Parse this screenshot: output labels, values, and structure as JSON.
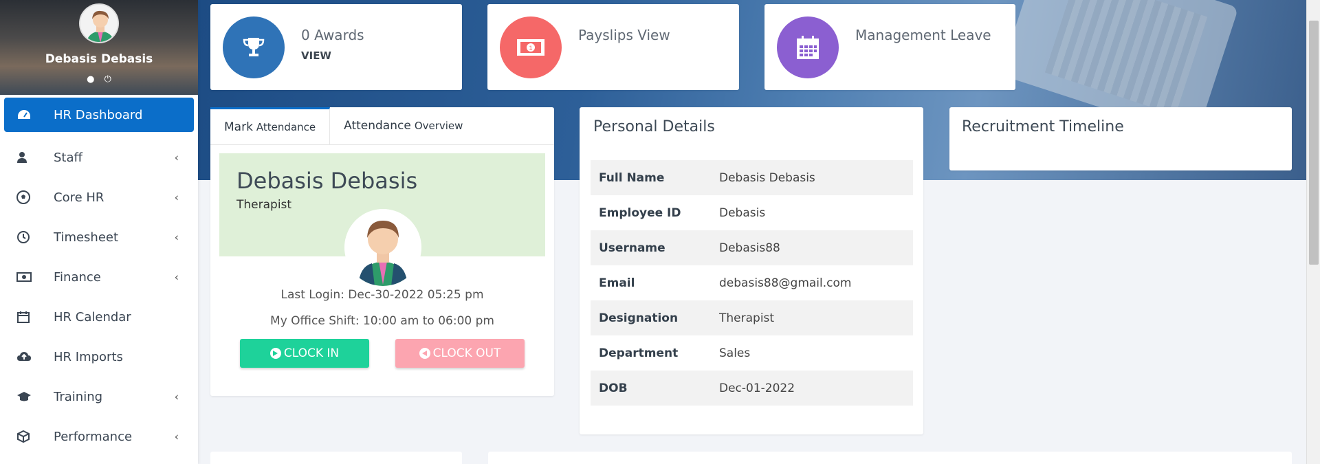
{
  "sidebar": {
    "profile": {
      "name": "Debasis Debasis"
    },
    "items": [
      {
        "label": "HR Dashboard",
        "icon": "dashboard-icon",
        "active": true,
        "has_submenu": false
      },
      {
        "label": "Staff",
        "icon": "user-icon",
        "has_submenu": true
      },
      {
        "label": "Core HR",
        "icon": "soccer-ball-icon",
        "has_submenu": true
      },
      {
        "label": "Timesheet",
        "icon": "clock-icon",
        "has_submenu": true
      },
      {
        "label": "Finance",
        "icon": "money-bill-icon",
        "has_submenu": true
      },
      {
        "label": "HR Calendar",
        "icon": "calendar-icon",
        "has_submenu": false
      },
      {
        "label": "HR Imports",
        "icon": "cloud-upload-icon",
        "has_submenu": false
      },
      {
        "label": "Training",
        "icon": "graduation-cap-icon",
        "has_submenu": true
      },
      {
        "label": "Performance",
        "icon": "cube-icon",
        "has_submenu": true
      }
    ]
  },
  "stats": [
    {
      "title": "0 Awards",
      "sub": "VIEW",
      "icon": "trophy-icon",
      "color": "#2f73b7"
    },
    {
      "title": "Payslips View",
      "sub": "",
      "icon": "money-bill-icon",
      "color": "#f56868"
    },
    {
      "title": "Management Leave",
      "sub": "",
      "icon": "calendar-icon",
      "color": "#8b5fd1"
    }
  ],
  "attendance": {
    "tabs": [
      {
        "main": "Mark",
        "small": "Attendance"
      },
      {
        "main": "Attendance",
        "small": "Overview"
      }
    ],
    "employee_name": "Debasis Debasis",
    "employee_role": "Therapist",
    "last_login": "Last Login: Dec-30-2022 05:25 pm",
    "office_shift": "My Office Shift: 10:00 am to 06:00 pm",
    "clock_in_label": "CLOCK IN",
    "clock_out_label": "CLOCK OUT"
  },
  "personal_details": {
    "title": "Personal Details",
    "rows": [
      {
        "key": "Full Name",
        "value": "Debasis Debasis"
      },
      {
        "key": "Employee ID",
        "value": "Debasis"
      },
      {
        "key": "Username",
        "value": "Debasis88"
      },
      {
        "key": "Email",
        "value": "debasis88@gmail.com"
      },
      {
        "key": "Designation",
        "value": "Therapist"
      },
      {
        "key": "Department",
        "value": "Sales"
      },
      {
        "key": "DOB",
        "value": "Dec-01-2022"
      }
    ]
  },
  "recruitment": {
    "title": "Recruitment Timeline"
  },
  "colors": {
    "primary": "#0b6ec9",
    "clock_in": "#1ed29a",
    "clock_out": "#fca5b0",
    "banner": "#2d5f98"
  }
}
